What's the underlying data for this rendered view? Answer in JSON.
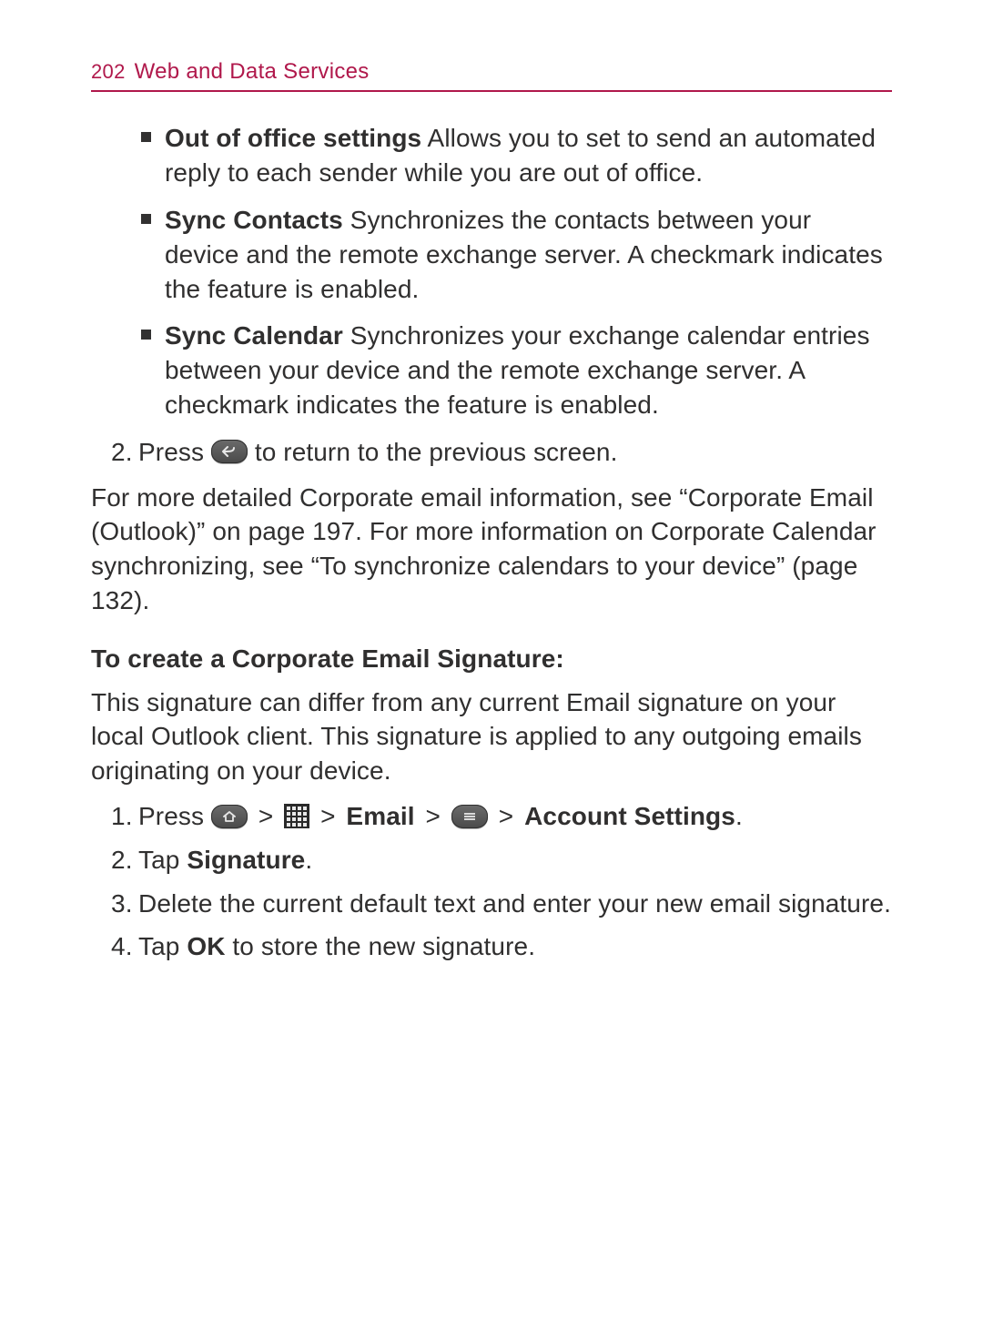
{
  "header": {
    "page_number": "202",
    "section_title": "Web and Data Services"
  },
  "bullets": [
    {
      "term": "Out of office settings",
      "desc": " Allows you to set to send an automated reply to each sender while you are out of office."
    },
    {
      "term": "Sync Contacts",
      "desc": " Synchronizes the contacts between your device and the remote exchange server. A checkmark indicates the feature is enabled."
    },
    {
      "term": "Sync Calendar",
      "desc": " Synchronizes your exchange calendar entries between your device and the remote exchange server. A checkmark indicates the feature is enabled."
    }
  ],
  "step2": {
    "pre": "Press ",
    "post": " to return to the previous screen."
  },
  "ref_para": "For more detailed Corporate email information, see “Corporate Email (Outlook)” on page 197. For more information on Corporate Calendar synchronizing, see “To synchronize calendars to your device” (page 132).",
  "sig": {
    "heading": "To create a Corporate Email Signature:",
    "intro": "This signature can differ from any current Email signature on your local Outlook client. This signature is applied to any outgoing emails originating on your device.",
    "step1": {
      "press": "Press ",
      "sep": " > ",
      "email": "Email",
      "acct": "Account Settings",
      "period": "."
    },
    "step2": {
      "pre": "Tap ",
      "bold": "Signature",
      "post": "."
    },
    "step3": "Delete the current default text and enter your new email signature.",
    "step4": {
      "pre": "Tap ",
      "bold": "OK",
      "post": " to store the new signature."
    }
  }
}
